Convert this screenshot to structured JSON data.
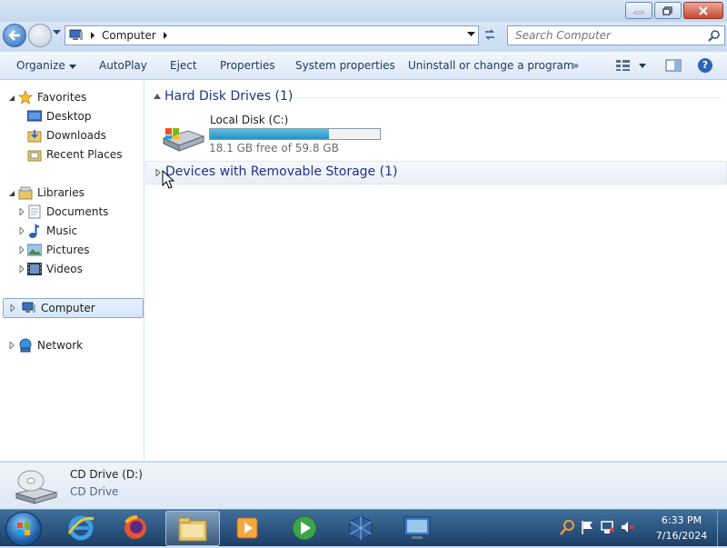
{
  "address": {
    "crumb": "Computer"
  },
  "search": {
    "placeholder": "Search Computer"
  },
  "commands": [
    "Organize",
    "AutoPlay",
    "Eject",
    "Properties",
    "System properties",
    "Uninstall or change a program",
    "»"
  ],
  "nav": {
    "favorites": "Favorites",
    "desktop": "Desktop",
    "downloads": "Downloads",
    "recent_places": "Recent Places",
    "libraries": "Libraries",
    "documents": "Documents",
    "music": "Music",
    "pictures": "Pictures",
    "videos": "Videos",
    "computer": "Computer",
    "network": "Network"
  },
  "groups": {
    "hard_disk": "Hard Disk Drives (1)",
    "removable": "Devices with Removable Storage (1)"
  },
  "drive": {
    "name": "Local Disk (C:)",
    "free_text": "18.1 GB free of 59.8 GB",
    "used_fraction": 0.7
  },
  "details": {
    "name": "CD Drive (D:)",
    "type": "CD Drive"
  },
  "clock": {
    "time": "6:33 PM",
    "date": "7/16/2024"
  },
  "colors": {
    "group_header": "#1e3287",
    "drive_bar": "#2a8fc2"
  }
}
